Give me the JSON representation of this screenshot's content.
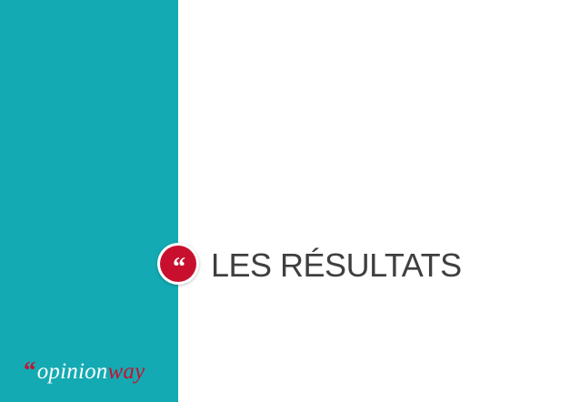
{
  "slide": {
    "title": "LES RÉSULTATS",
    "quote_glyph": "“"
  },
  "brand": {
    "quote_mark": "“",
    "name_part_1": "opinion",
    "name_part_2": "way"
  },
  "colors": {
    "panel": "#14aab3",
    "accent": "#c8102e",
    "title": "#3f3f3f",
    "background": "#ffffff"
  },
  "icons": {
    "badge": "quote-icon"
  }
}
